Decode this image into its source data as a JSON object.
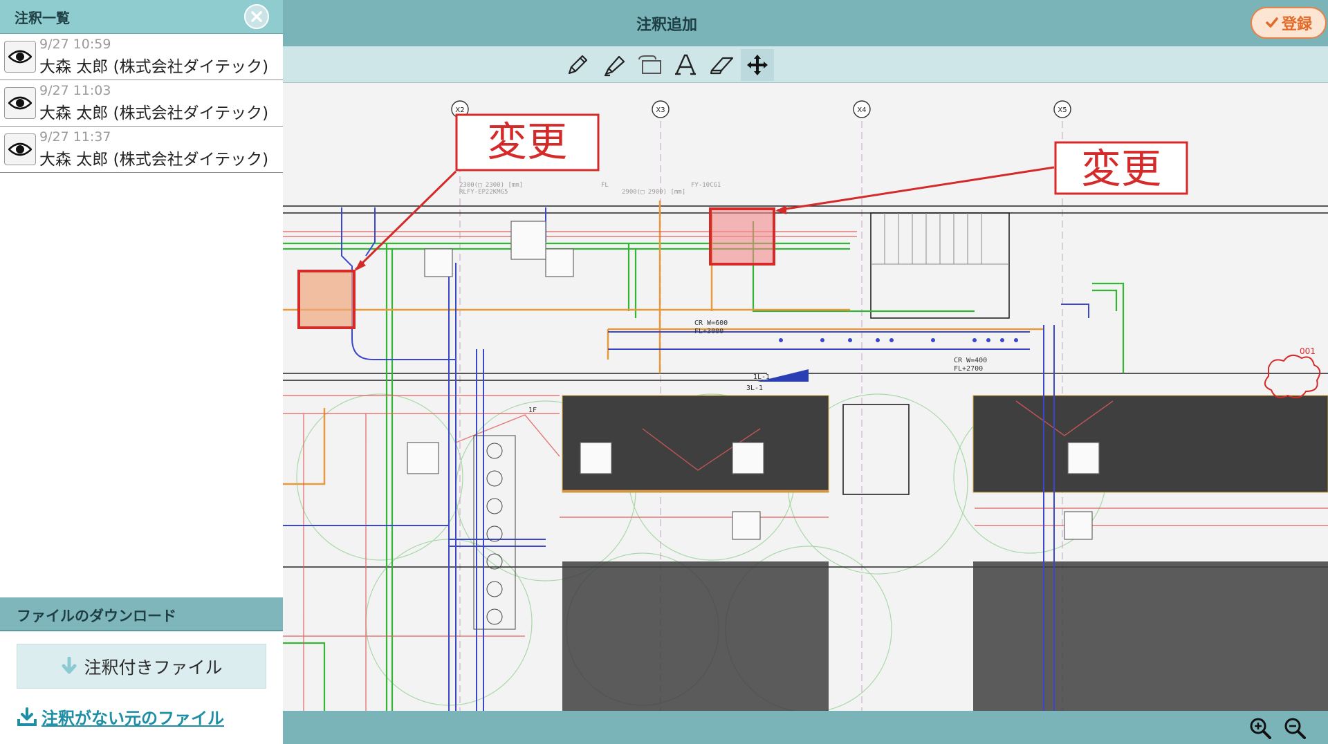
{
  "left_panel": {
    "annotation_list_title": "注釈一覧",
    "close_icon": "close-circle-icon",
    "items": [
      {
        "time": "9/27 10:59",
        "author": "大森 太郎 (株式会社ダイテック)",
        "icon": "eye-icon"
      },
      {
        "time": "9/27 11:03",
        "author": "大森 太郎 (株式会社ダイテック)",
        "icon": "eye-icon"
      },
      {
        "time": "9/27 11:37",
        "author": "大森 太郎 (株式会社ダイテック)",
        "icon": "eye-icon"
      }
    ],
    "download": {
      "title": "ファイルのダウンロード",
      "annotated_file": "注釈付きファイル",
      "original_file": "注釈がない元のファイル"
    }
  },
  "main": {
    "title": "注釈追加",
    "register_label": "登録",
    "toolbar": [
      "pencil-icon",
      "marker-icon",
      "callout-icon",
      "text-icon",
      "eraser-icon",
      "move-icon"
    ],
    "active_tool": "move-icon",
    "drawing": {
      "grid_labels": [
        "X2",
        "X3",
        "X4",
        "X5"
      ],
      "annotations": [
        {
          "text": "変更"
        },
        {
          "text": "変更"
        }
      ],
      "plan_labels": [
        "CR W=600",
        "FL+3000",
        "CR W=400",
        "FL+2700",
        "1L-1",
        "3L-1",
        "FY-10CG1",
        "FL",
        "2900(□ 2900) [mm]",
        "2300(□ 2300) [mm]",
        "RLFY-EP22KMG5",
        "1F",
        "001"
      ],
      "colors": {
        "red_markup": "#d42a2a",
        "annotation_fill": "#f1a77d"
      }
    },
    "zoom_in_icon": "zoom-in-icon",
    "zoom_out_icon": "zoom-out-icon"
  },
  "colors": {
    "header_teal": "#7ab3b8",
    "toolbar_bg": "#cfe6e8",
    "accent_orange": "#e36b2a",
    "link_blue": "#1c8fa6"
  }
}
